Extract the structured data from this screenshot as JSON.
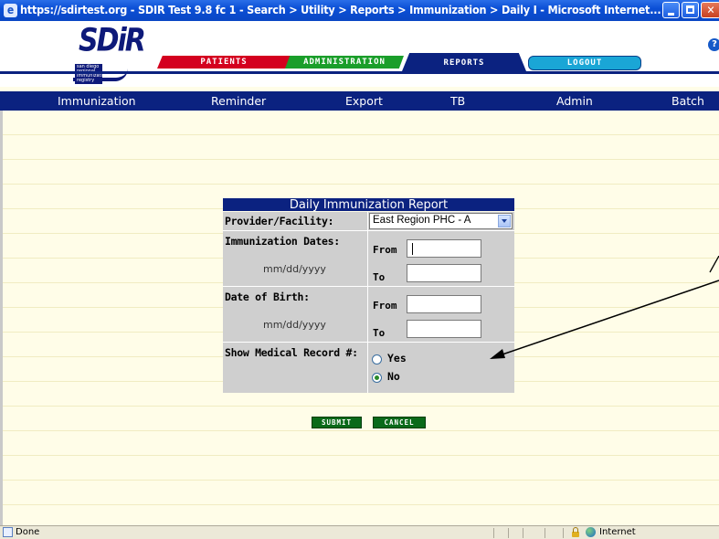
{
  "window": {
    "title": "https://sdirtest.org - SDIR Test 9.8 fc 1 - Search > Utility > Reports > Immunization > Daily I - Microsoft Internet..."
  },
  "header": {
    "logo_text": "SDiR",
    "logo_subtext": "san diego regional immunization registry",
    "tabs": {
      "patients": "PATIENTS",
      "administration": "ADMINISTRATION",
      "reports": "REPORTS",
      "logout": "LOGOUT"
    },
    "help_glyph": "?"
  },
  "nav": {
    "items": [
      {
        "label": "Immunization"
      },
      {
        "label": "Reminder"
      },
      {
        "label": "Export"
      },
      {
        "label": "TB"
      },
      {
        "label": "Admin"
      },
      {
        "label": "Batch"
      }
    ]
  },
  "form": {
    "title": "Daily Immunization Report",
    "provider_label": "Provider/Facility:",
    "provider_value": "East Region PHC - A",
    "imm_dates_label": "Immunization Dates:",
    "imm_dates_format": "mm/dd/yyyy",
    "dob_label": "Date of Birth:",
    "dob_format": "mm/dd/yyyy",
    "from_label": "From",
    "to_label": "To",
    "imm_from_value": "",
    "imm_to_value": "",
    "dob_from_value": "",
    "dob_to_value": "",
    "medrec_label": "Show Medical Record #:",
    "radio_yes": "Yes",
    "radio_no": "No",
    "selected_option": "No"
  },
  "actions": {
    "submit": "SUBMIT",
    "cancel": "CANCEL"
  },
  "statusbar": {
    "status": "Done",
    "zone": "Internet"
  },
  "colors": {
    "nav_blue": "#0b2280",
    "patients_tab": "#d4001f",
    "admin_tab": "#1a9e2a",
    "logout_tab": "#1aa6d6",
    "action_green": "#0a6a1a",
    "page_bg": "#fffde8"
  }
}
